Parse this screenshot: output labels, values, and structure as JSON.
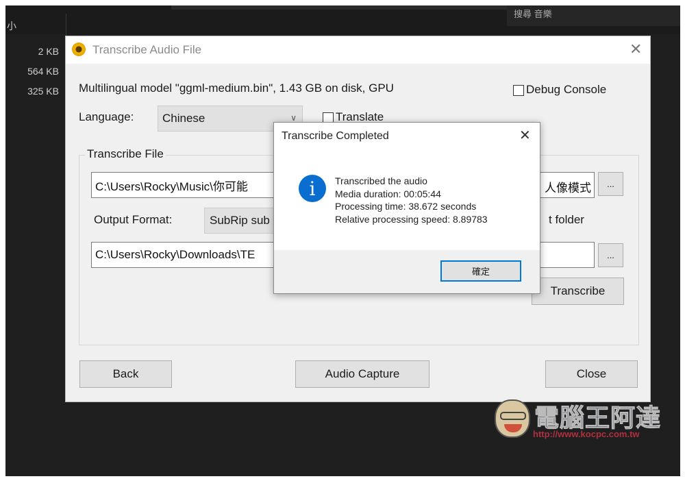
{
  "background": {
    "column_header": "小",
    "top_right_text": "搜尋 音樂",
    "file_sizes": [
      "2 KB",
      "564 KB",
      "325 KB"
    ]
  },
  "dialog": {
    "title": "Transcribe Audio File",
    "model_info": "Multilingual model \"ggml-medium.bin\", 1.43 GB on disk, GPU",
    "debug_console_label": "Debug Console",
    "debug_console_checked": false,
    "language_label": "Language:",
    "language_value": "Chinese",
    "translate_label": "Translate",
    "translate_checked": false,
    "group_title": "Transcribe File",
    "input_path": "C:\\Users\\Rocky\\Music\\你可能",
    "input_path_tail": "人像模式",
    "browse_label": "...",
    "output_format_label": "Output Format:",
    "output_format_value": "SubRip sub",
    "output_folder_label": "t folder",
    "output_path": "C:\\Users\\Rocky\\Downloads\\TE",
    "transcribe_button": "Transcribe",
    "back_button": "Back",
    "audio_capture_button": "Audio Capture",
    "close_button": "Close"
  },
  "message_box": {
    "title": "Transcribe Completed",
    "lines": [
      "Transcribed the audio",
      "Media duration: 00:05:44",
      "Processing time: 38.672 seconds",
      "Relative processing speed: 8.89783"
    ],
    "ok_button": "確定"
  },
  "watermark": {
    "name": "電腦王阿達",
    "url": "http://www.kocpc.com.tw"
  },
  "colors": {
    "info_icon": "#0a6ed1",
    "background": "#1f1f1f",
    "dialog": "#f0f0f0",
    "focus_border": "#0078d7"
  }
}
